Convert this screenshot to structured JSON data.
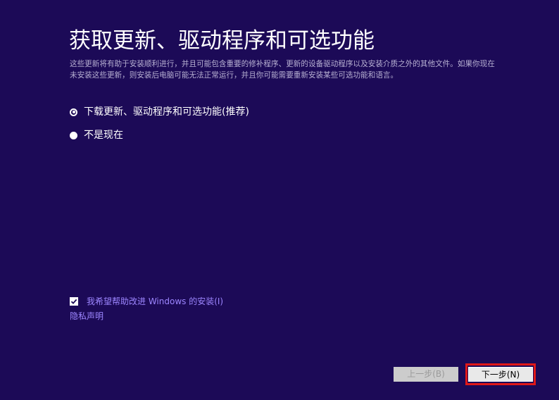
{
  "title": "获取更新、驱动程序和可选功能",
  "description": "这些更新将有助于安装顺利进行，并且可能包含重要的修补程序、更新的设备驱动程序以及安装介质之外的其他文件。如果你现在未安装这些更新，则安装后电脑可能无法正常运行，并且你可能需要重新安装某些可选功能和语言。",
  "options": [
    {
      "label": "下载更新、驱动程序和可选功能(推荐)",
      "selected": true
    },
    {
      "label": "不是现在",
      "selected": false
    }
  ],
  "improve": {
    "label": "我希望帮助改进 Windows 的安装(I)",
    "checked": true
  },
  "privacy_label": "隐私声明",
  "buttons": {
    "back_label": "上一步(B)",
    "back_enabled": false,
    "next_label": "下一步(N)"
  },
  "colors": {
    "background": "#1c0a57",
    "link": "#9d86ff",
    "highlight": "#e01818"
  }
}
